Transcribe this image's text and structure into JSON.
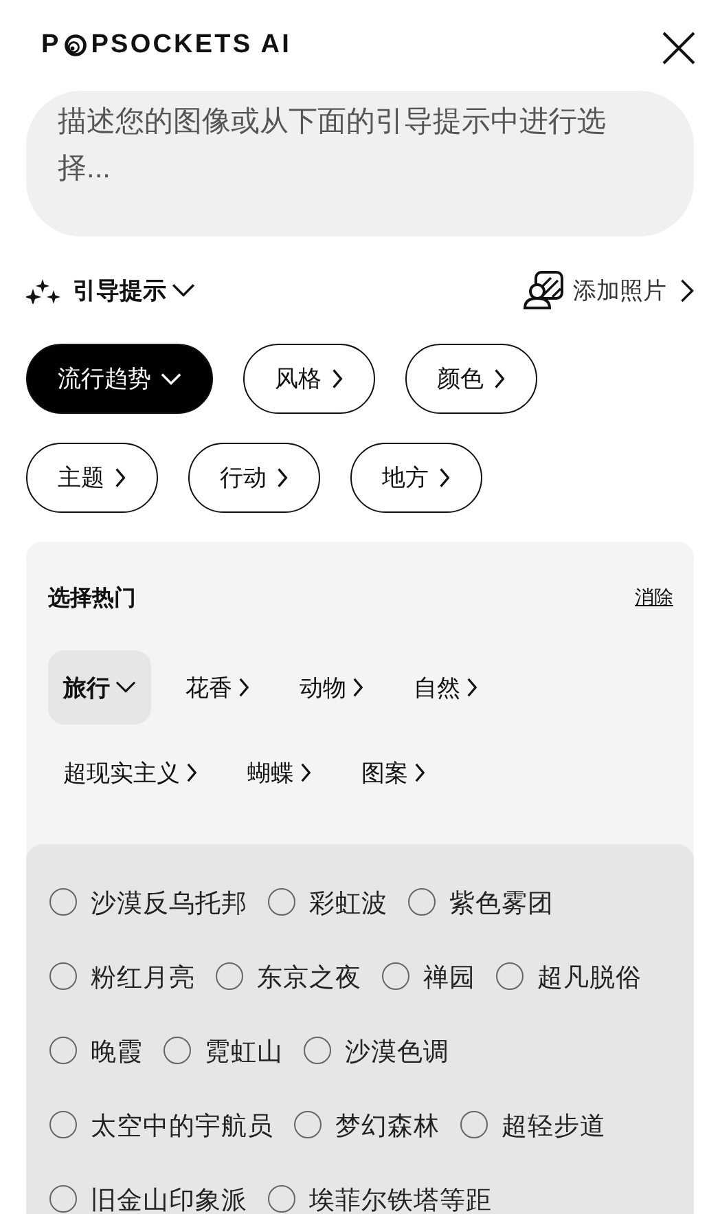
{
  "header": {
    "logo_start": "P",
    "logo_end": "PSOCKETS AI"
  },
  "prompt": {
    "placeholder": "描述您的图像或从下面的引导提示中进行选择..."
  },
  "guided": {
    "label": "引导提示",
    "expanded": true
  },
  "add_photo": {
    "label": "添加照片"
  },
  "categories": [
    {
      "label": "流行趋势",
      "selected": true
    },
    {
      "label": "风格",
      "selected": false
    },
    {
      "label": "颜色",
      "selected": false
    },
    {
      "label": "主题",
      "selected": false
    },
    {
      "label": "行动",
      "selected": false
    },
    {
      "label": "地方",
      "selected": false
    }
  ],
  "panel": {
    "title": "选择热门",
    "clear": "消除"
  },
  "subcategories": [
    {
      "label": "旅行",
      "selected": true
    },
    {
      "label": "花香",
      "selected": false
    },
    {
      "label": "动物",
      "selected": false
    },
    {
      "label": "自然",
      "selected": false
    },
    {
      "label": "超现实主义",
      "selected": false
    },
    {
      "label": "蝴蝶",
      "selected": false
    },
    {
      "label": "图案",
      "selected": false
    }
  ],
  "option_rows": [
    {
      "items": [
        {
          "label": "沙漠反乌托邦",
          "selected": false
        },
        {
          "label": "彩虹波",
          "selected": false
        },
        {
          "label": "紫色雾团",
          "selected": false
        }
      ]
    },
    {
      "items": [
        {
          "label": "粉红月亮",
          "selected": false
        },
        {
          "label": "东京之夜",
          "selected": false
        },
        {
          "label": "禅园",
          "selected": false
        },
        {
          "label": "超凡脱俗",
          "selected": false
        }
      ]
    },
    {
      "items": [
        {
          "label": "晚霞",
          "selected": false
        },
        {
          "label": "霓虹山",
          "selected": false
        },
        {
          "label": "沙漠色调",
          "selected": false
        }
      ]
    },
    {
      "items": [
        {
          "label": "太空中的宇航员",
          "selected": false
        },
        {
          "label": "梦幻森林",
          "selected": false
        },
        {
          "label": "超轻步道",
          "selected": false
        }
      ]
    },
    {
      "items": [
        {
          "label": "旧金山印象派",
          "selected": false
        },
        {
          "label": "埃菲尔铁塔等距",
          "selected": false
        }
      ]
    }
  ]
}
